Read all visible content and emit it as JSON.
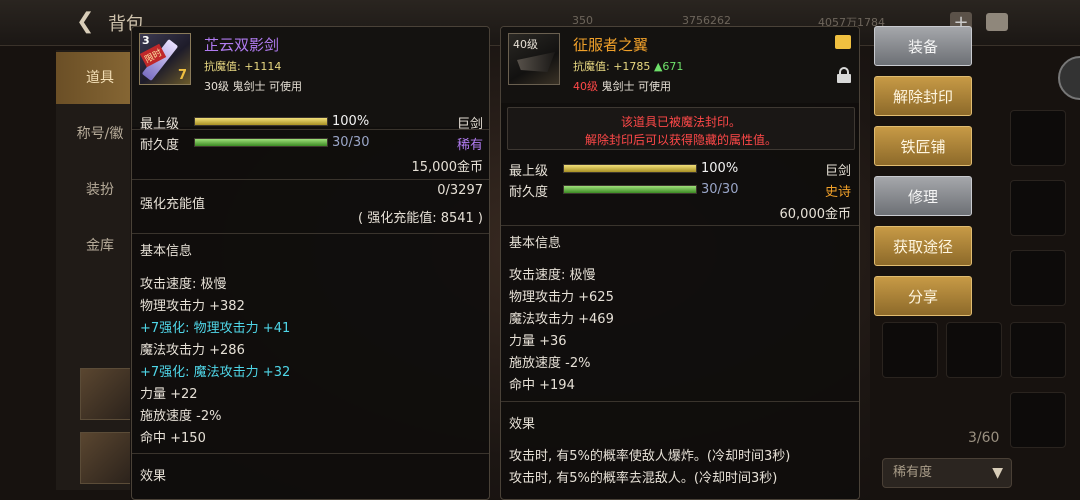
{
  "background": {
    "title": "背包",
    "currencies": [
      "350",
      "3756262",
      "4057万1784"
    ],
    "left_tabs": [
      "道具",
      "称号/徽",
      "装扮",
      "金库"
    ],
    "inventory_count": "3/60",
    "rarity_filter": "稀有度"
  },
  "left_item": {
    "icon": {
      "level_tag": "3",
      "ribbon": "限时",
      "enhance": "7"
    },
    "name": "芷云双影剑",
    "anti_magic_label": "抗魔值:",
    "anti_magic_value": "+1114",
    "requirement": "30级 鬼剑士 可使用",
    "grade_label": "最上级",
    "grade_percent_text": "100%",
    "grade_fraction": 1.0,
    "weapon_type": "巨剑",
    "durability_label": "耐久度",
    "durability_text": "30/30",
    "durability_fraction": 1.0,
    "rarity": "稀有",
    "price": "15,000金币",
    "charge_label": "强化充能值",
    "charge_value": "0/3297",
    "charge_total": "( 强化充能值: 8541 )",
    "basic_info_title": "基本信息",
    "stats": [
      {
        "text": "攻击速度: 极慢",
        "style": "normal"
      },
      {
        "text": "物理攻击力 +382",
        "style": "normal"
      },
      {
        "text": "+7强化: 物理攻击力 +41",
        "style": "cyan"
      },
      {
        "text": "魔法攻击力 +286",
        "style": "normal"
      },
      {
        "text": "+7强化: 魔法攻击力 +32",
        "style": "cyan"
      },
      {
        "text": "力量 +22",
        "style": "normal"
      },
      {
        "text": "施放速度 -2%",
        "style": "normal"
      },
      {
        "text": "命中 +150",
        "style": "normal"
      }
    ],
    "effect_title": "效果"
  },
  "right_item": {
    "icon": {
      "level_tag": "40级"
    },
    "name": "征服者之翼",
    "anti_magic_label": "抗魔值:",
    "anti_magic_value": "+1785",
    "anti_magic_diff": "▲671",
    "requirement_level": "40级",
    "requirement_rest": "鬼剑士 可使用",
    "seal_line1": "该道具已被魔法封印。",
    "seal_line2": "解除封印后可以获得隐藏的属性值。",
    "grade_label": "最上级",
    "grade_percent_text": "100%",
    "grade_fraction": 1.0,
    "weapon_type": "巨剑",
    "durability_label": "耐久度",
    "durability_text": "30/30",
    "durability_fraction": 1.0,
    "rarity": "史诗",
    "price": "60,000金币",
    "basic_info_title": "基本信息",
    "stats": [
      "攻击速度: 极慢",
      "物理攻击力 +625",
      "魔法攻击力 +469",
      "力量 +36",
      "施放速度 -2%",
      "命中 +194"
    ],
    "effect_title": "效果",
    "effect_line1": "攻击时, 有5%的概率使敌人爆炸。(冷却时间3秒)",
    "effect_line2": "攻击时, 有5%的概率去混敌人。(冷却时间3秒)"
  },
  "actions": [
    "装备",
    "解除封印",
    "铁匠铺",
    "修理",
    "获取途径",
    "分享"
  ],
  "action_styles": [
    "gray",
    "gold",
    "gold",
    "gray",
    "gold",
    "gold"
  ],
  "colors": {
    "epic": "#f0a02a",
    "rare": "#b07bf0",
    "enhance": "#4fd6e8",
    "warning": "#ff4848"
  }
}
